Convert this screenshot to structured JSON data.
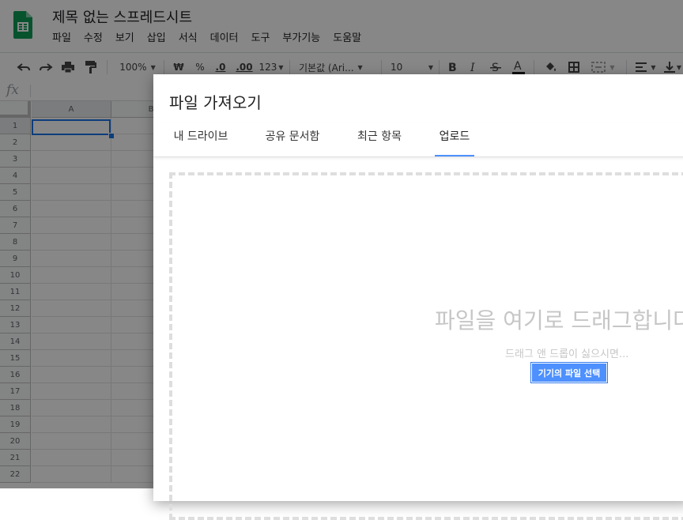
{
  "app": {
    "doc_title": "제목 없는 스프레드시트",
    "menu": [
      "파일",
      "수정",
      "보기",
      "삽입",
      "서식",
      "데이터",
      "도구",
      "부가기능",
      "도움말"
    ]
  },
  "toolbar": {
    "zoom": "100%",
    "currency": "₩",
    "percent": "%",
    "decrease_decimal": ".0",
    "increase_decimal": ".00",
    "more_formats": "123",
    "font_name": "기본값 (Ari...",
    "font_size": "10"
  },
  "formula_bar": {
    "fx_label": "fx"
  },
  "sheet": {
    "columns": [
      "A",
      "B"
    ],
    "rows": [
      "1",
      "2",
      "3",
      "4",
      "5",
      "6",
      "7",
      "8",
      "9",
      "10",
      "11",
      "12",
      "13",
      "14",
      "15",
      "16",
      "17",
      "18",
      "19",
      "20",
      "21",
      "22"
    ],
    "active_cell": "A1"
  },
  "dialog": {
    "title": "파일 가져오기",
    "tabs": [
      "내 드라이브",
      "공유 문서함",
      "최근 항목",
      "업로드"
    ],
    "active_tab": "업로드",
    "drop_title": "파일을 여기로 드래그합니다",
    "drop_subtitle": "드래그 앤 드롭이 싫으시면...",
    "select_button": "기기의 파일 선택"
  },
  "colors": {
    "accent_blue": "#4d90fe",
    "selection_blue": "#1a73e8",
    "sheets_green": "#0f9d58"
  }
}
